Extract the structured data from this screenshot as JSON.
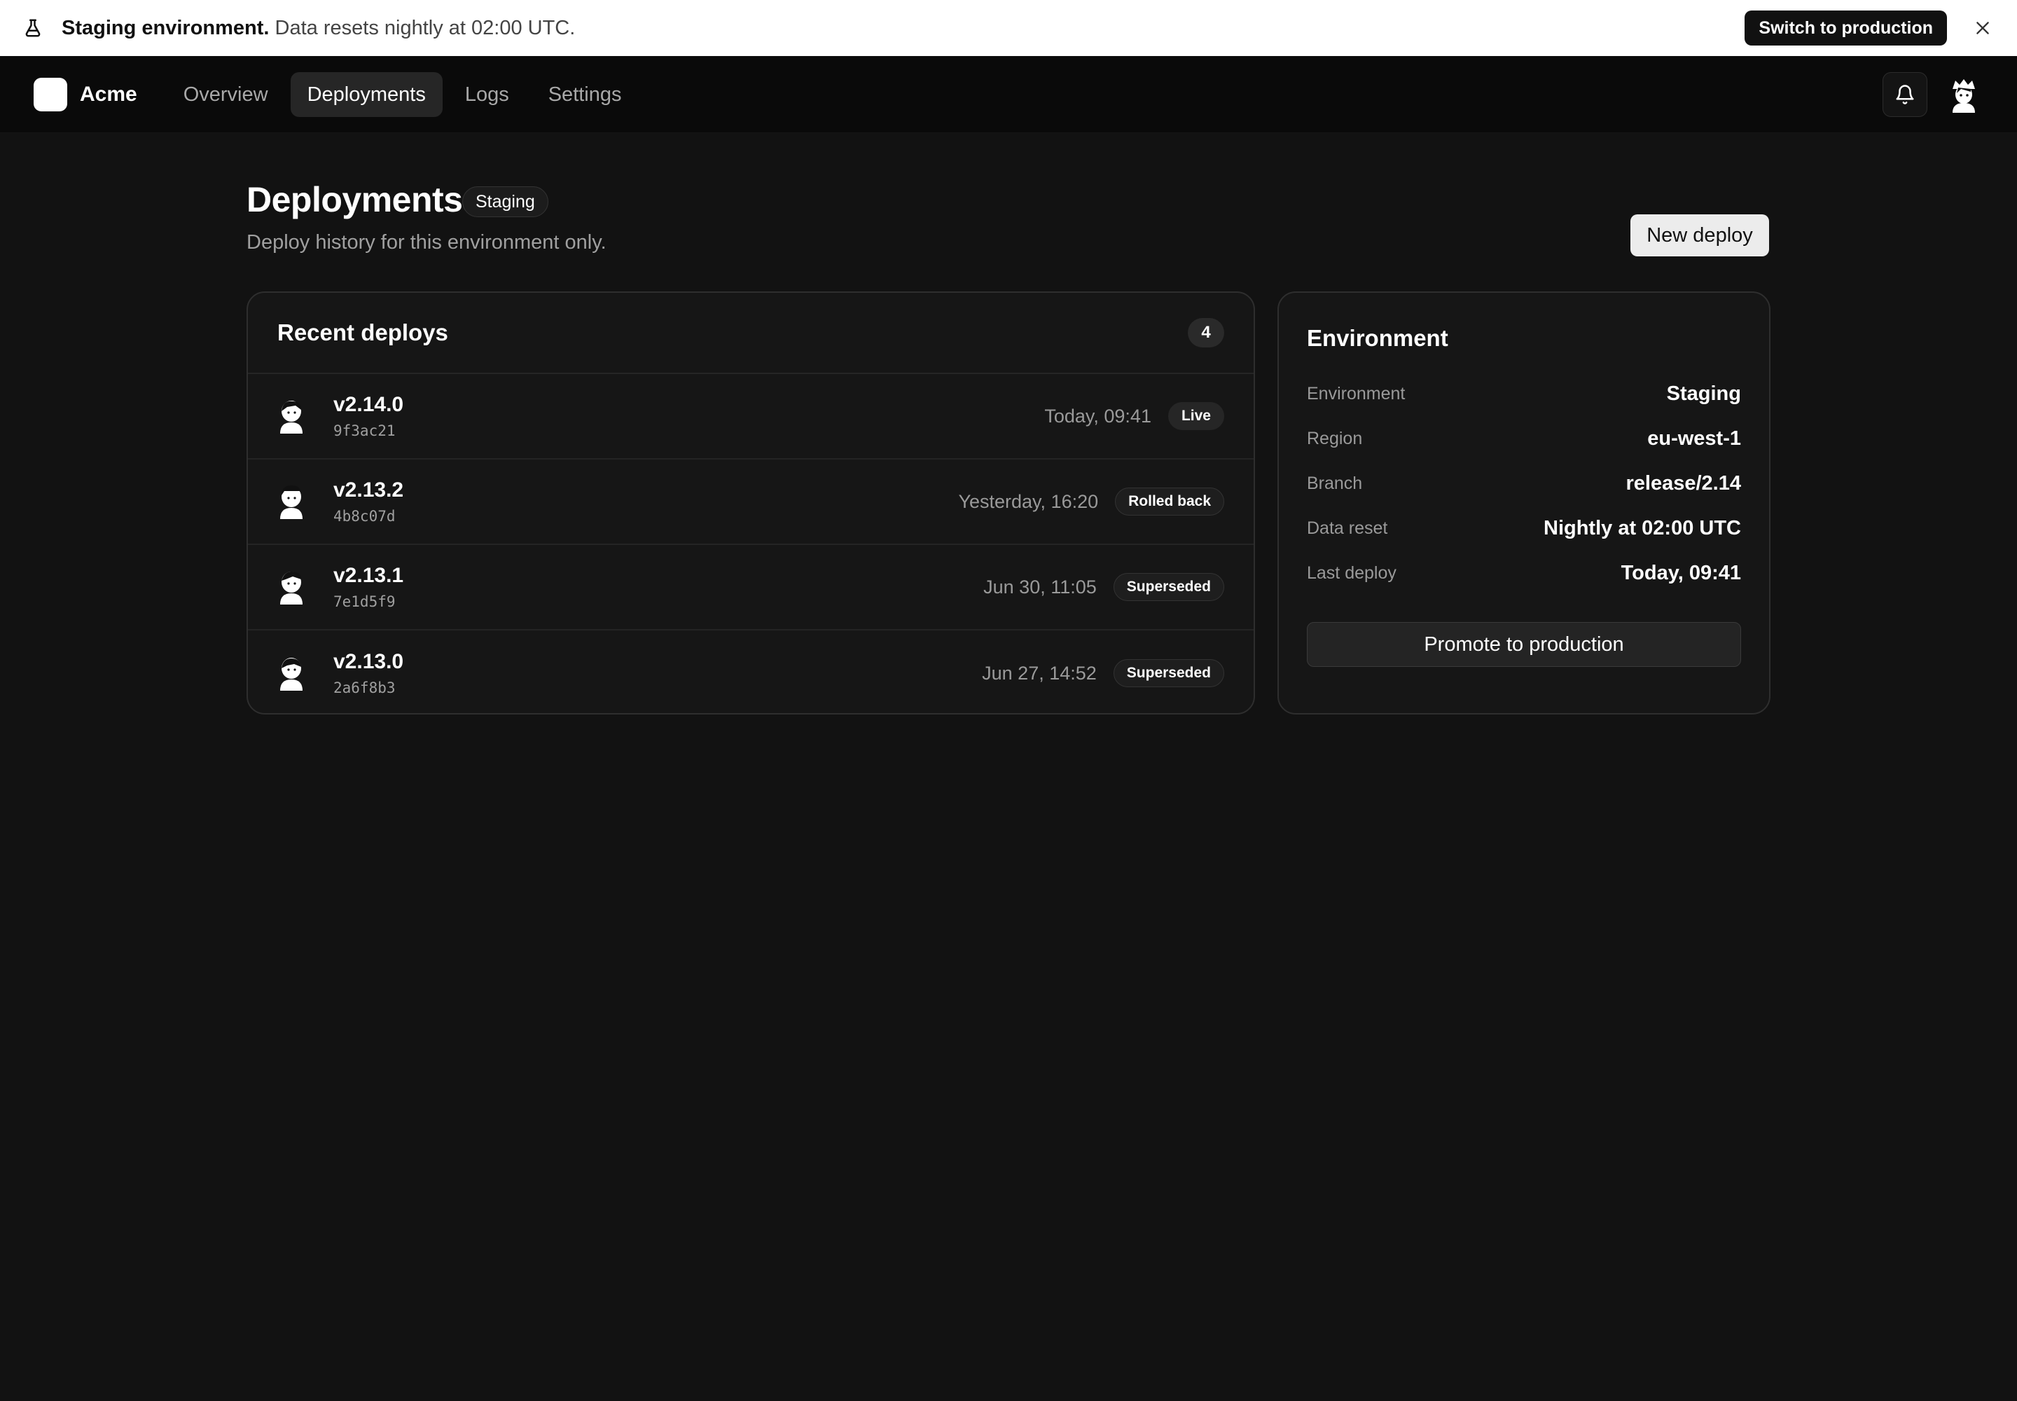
{
  "banner": {
    "title": "Staging environment.",
    "message": " Data resets nightly at 02:00 UTC.",
    "switch_label": "Switch to production"
  },
  "nav": {
    "brand": "Acme",
    "items": [
      {
        "label": "Overview",
        "active": false
      },
      {
        "label": "Deployments",
        "active": true
      },
      {
        "label": "Logs",
        "active": false
      },
      {
        "label": "Settings",
        "active": false
      }
    ]
  },
  "page": {
    "title": "Deployments",
    "badge": "Staging",
    "subtitle": "Deploy history for this environment only.",
    "new_deploy_label": "New deploy"
  },
  "deploys": {
    "title": "Recent deploys",
    "count": "4",
    "rows": [
      {
        "version": "v2.14.0",
        "hash": "9f3ac21",
        "time": "Today, 09:41",
        "status": "Live"
      },
      {
        "version": "v2.13.2",
        "hash": "4b8c07d",
        "time": "Yesterday, 16:20",
        "status": "Rolled back"
      },
      {
        "version": "v2.13.1",
        "hash": "7e1d5f9",
        "time": "Jun 30, 11:05",
        "status": "Superseded"
      },
      {
        "version": "v2.13.0",
        "hash": "2a6f8b3",
        "time": "Jun 27, 14:52",
        "status": "Superseded"
      }
    ]
  },
  "environment": {
    "title": "Environment",
    "fields": [
      {
        "key": "Environment",
        "value": "Staging"
      },
      {
        "key": "Region",
        "value": "eu-west-1"
      },
      {
        "key": "Branch",
        "value": "release/2.14"
      },
      {
        "key": "Data reset",
        "value": "Nightly at 02:00 UTC"
      },
      {
        "key": "Last deploy",
        "value": "Today, 09:41"
      }
    ],
    "promote_label": "Promote to production"
  },
  "icons": {
    "banner": "flask-icon",
    "close": "close-icon",
    "notifications": "bell-icon",
    "user": "avatar"
  }
}
